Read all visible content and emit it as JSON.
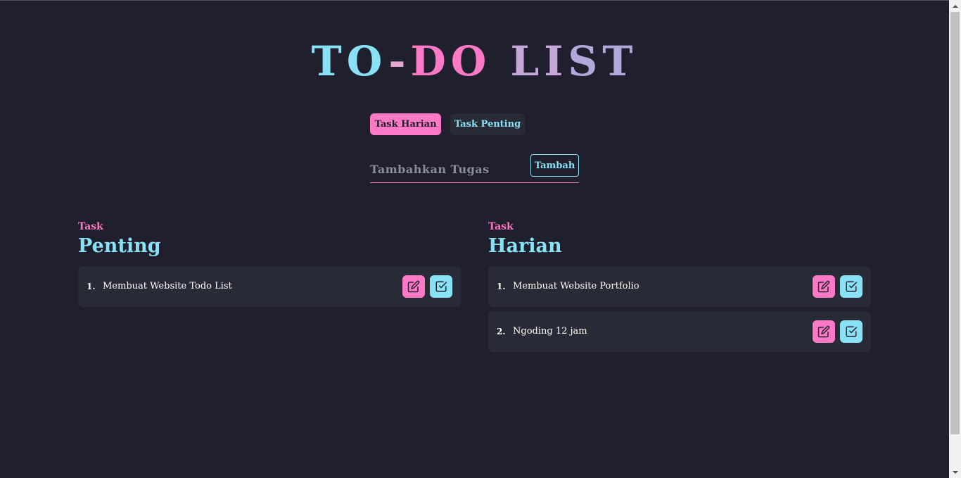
{
  "title": {
    "part1": "TO",
    "dash": "-",
    "part2": "DO",
    "part3": "LI",
    "part4": "ST"
  },
  "tabs": [
    {
      "label": "Task Harian",
      "active": true
    },
    {
      "label": "Task Penting",
      "active": false
    }
  ],
  "input": {
    "placeholder": "Tambahkan Tugas",
    "value": "",
    "button_label": "Tambah"
  },
  "columns": {
    "penting": {
      "small_label": "Task",
      "big_label": "Penting",
      "tasks": [
        {
          "number": "1.",
          "text": "Membuat Website Todo List"
        }
      ]
    },
    "harian": {
      "small_label": "Task",
      "big_label": "Harian",
      "tasks": [
        {
          "number": "1.",
          "text": "Membuat Website Portfolio"
        },
        {
          "number": "2.",
          "text": "Ngoding 12 jam"
        }
      ]
    }
  },
  "icons": {
    "edit": "edit-icon",
    "check": "check-square-icon"
  },
  "colors": {
    "background": "#1f1f2d",
    "panel": "#282a36",
    "accent_pink": "#ff79c6",
    "accent_cyan": "#89e1f5"
  }
}
